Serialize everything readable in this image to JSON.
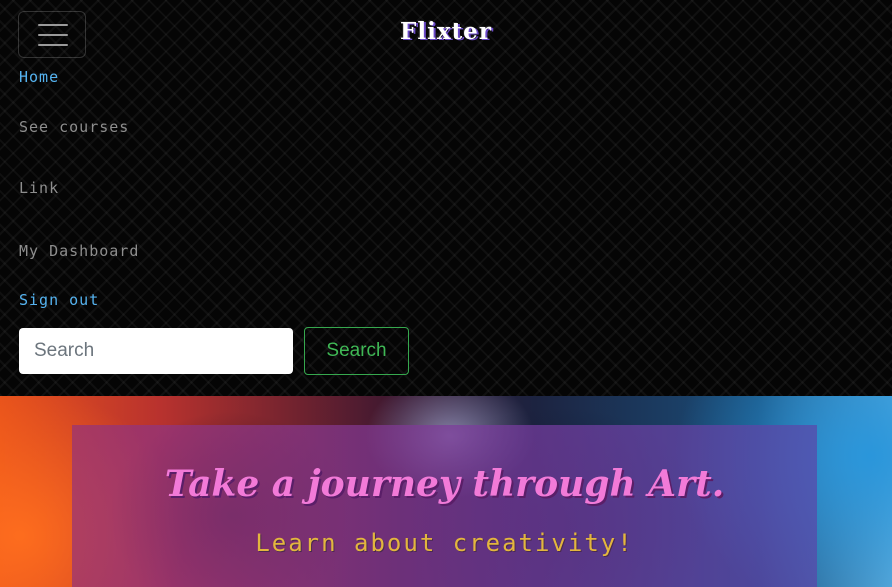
{
  "navbar": {
    "brand": "Flixter",
    "toggler_icon": "hamburger-icon",
    "links": [
      {
        "label": "Home",
        "active": true
      },
      {
        "label": "See courses",
        "active": false
      },
      {
        "label": "Link",
        "active": false
      },
      {
        "label": "My Dashboard",
        "active": false
      },
      {
        "label": "Sign out",
        "active": true
      }
    ],
    "search": {
      "placeholder": "Search",
      "button_label": "Search"
    }
  },
  "hero": {
    "title": "Take a journey through Art.",
    "subtitle": "Learn about creativity!"
  },
  "colors": {
    "active_link": "#55b3f0",
    "inactive_link": "#8e8e8e",
    "search_button": "#3fb855",
    "hero_title": "#f27ad8",
    "hero_subtitle": "#e3b63e"
  }
}
